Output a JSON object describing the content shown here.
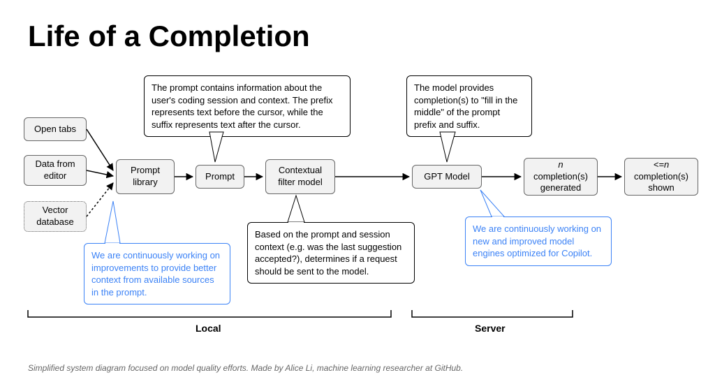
{
  "title": "Life of a Completion",
  "nodes": {
    "open_tabs": "Open tabs",
    "data_from_editor": "Data from editor",
    "vector_database": "Vector database",
    "prompt_library": "Prompt library",
    "prompt": "Prompt",
    "contextual_filter": "Contextual filter model",
    "gpt_model": "GPT Model",
    "n_generated_prefix": "n",
    "n_generated_rest": " completion(s) generated",
    "n_shown_prefix": "<=n",
    "n_shown_rest": " completion(s) shown"
  },
  "callouts": {
    "prompt_info": "The prompt contains information about the user's coding session and context. The prefix represents text before the cursor, while the suffix represents text after the cursor.",
    "model_info": "The model provides completion(s) to \"fill in the middle\" of the prompt prefix and suffix.",
    "improve_context": "We are continuously working on improvements to provide better context from available sources in the prompt.",
    "filter_info": "Based on the prompt and session context (e.g. was the last suggestion accepted?), determines if a request should be sent to the model.",
    "engines_info": "We are continuously working on new and improved model engines optimized for Copilot."
  },
  "sections": {
    "local": "Local",
    "server": "Server"
  },
  "caption": "Simplified system diagram focused on model quality efforts. Made by Alice Li, machine learning researcher at GitHub."
}
